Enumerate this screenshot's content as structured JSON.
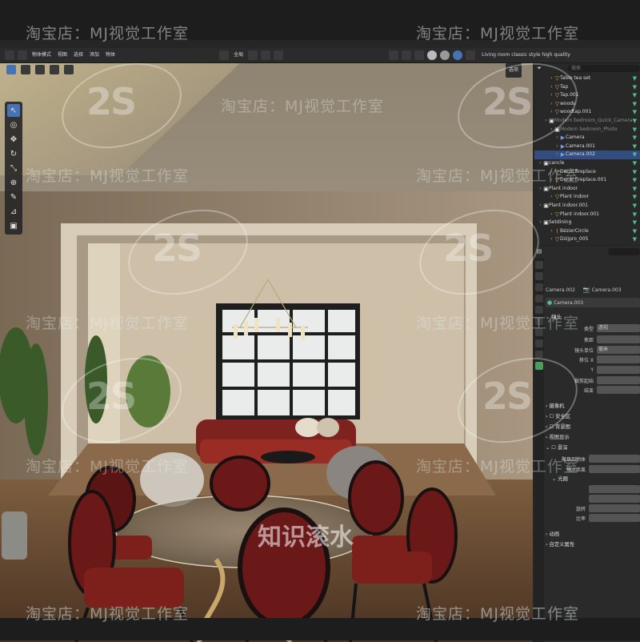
{
  "watermark": {
    "shop_text": "淘宝店：MJ视觉工作室",
    "logo_text": "2S",
    "center_text": "知识滚水"
  },
  "topbar": {
    "mode_label": "物体模式",
    "menus": [
      "视图",
      "选择",
      "添加",
      "物体"
    ],
    "transform_label": "全局",
    "scene_title": "Living room classic style high quality",
    "select_label": "选项",
    "search_placeholder": "搜索"
  },
  "outliner": {
    "rows": [
      {
        "label": "Table tea set",
        "indent": 2,
        "icon": "mesh-icon"
      },
      {
        "label": "Tap",
        "indent": 2,
        "icon": "mesh-icon"
      },
      {
        "label": "Tap.001",
        "indent": 2,
        "icon": "mesh-icon"
      },
      {
        "label": "woods",
        "indent": 2,
        "icon": "mesh-icon"
      },
      {
        "label": "woodtap.001",
        "indent": 2,
        "icon": "mesh-icon"
      },
      {
        "label": "Modern bedroom_Quick_Camera",
        "indent": 1,
        "icon": "collection-icon",
        "dim": true
      },
      {
        "label": "Modern bedroom_Photo",
        "indent": 2,
        "icon": "collection-icon",
        "dim": true
      },
      {
        "label": "Camera",
        "indent": 3,
        "icon": "camera-icon"
      },
      {
        "label": "Camera.001",
        "indent": 3,
        "icon": "camera-icon"
      },
      {
        "label": "Camera.002",
        "indent": 3,
        "icon": "camera-icon",
        "selected": true
      },
      {
        "label": "cancle",
        "indent": 0,
        "icon": "collection-icon"
      },
      {
        "label": "Decol fireplace",
        "indent": 2,
        "icon": "mesh-icon"
      },
      {
        "label": "Decol fireplace.001",
        "indent": 2,
        "icon": "mesh-icon"
      },
      {
        "label": "Plant indoor",
        "indent": 0,
        "icon": "collection-icon"
      },
      {
        "label": "Plant indoor",
        "indent": 2,
        "icon": "mesh-icon"
      },
      {
        "label": "Plant indoor.001",
        "indent": 0,
        "icon": "collection-icon"
      },
      {
        "label": "Plant indoor.001",
        "indent": 2,
        "icon": "mesh-icon"
      },
      {
        "label": "Setdining",
        "indent": 0,
        "icon": "collection-icon"
      },
      {
        "label": "BézierCircle",
        "indent": 2,
        "icon": "curve-icon"
      },
      {
        "label": "Dzijpro_005",
        "indent": 2,
        "icon": "mesh-icon"
      }
    ]
  },
  "properties": {
    "camera_object": "Camera.002",
    "camera_object_b": "Camera.003",
    "camera_data": "Camera.003",
    "lens_section": "镜头",
    "type_label": "类型",
    "type_value": "透视",
    "focal_label": "焦距",
    "lens_unit_label": "镜头单位",
    "lens_unit_value": "毫米",
    "shift_x_label": "移位 X",
    "shift_y_label": "Y",
    "clip_start_label": "裁剪起始",
    "clip_end_label": "结束",
    "sections": [
      "摄像机",
      "安全区",
      "背景图",
      "视图显示"
    ],
    "dof_label": "景深",
    "focus_object_label": "聚焦到物体",
    "focus_distance_label": "焦点距离",
    "aperture_label": "光圈",
    "aperture_fields": [
      "",
      "",
      "旋转",
      "比率"
    ],
    "animation_label": "动画",
    "custom_props_label": "自定义属性"
  }
}
